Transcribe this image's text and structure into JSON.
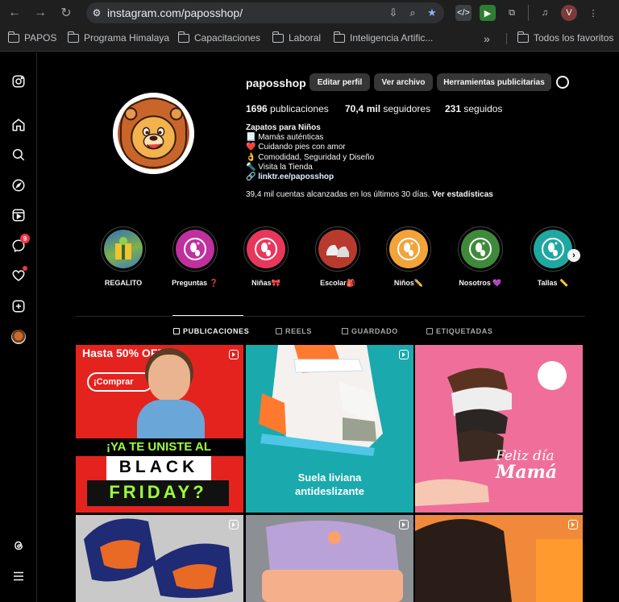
{
  "browser": {
    "url": "instagram.com/paposshop/",
    "profile_initial": "V",
    "bookmarks": [
      "PAPOS",
      "Programa Himalaya",
      "Capacitaciones",
      "Laboral",
      "Inteligencia Artific..."
    ],
    "more_label": "»",
    "all_bookmarks": "Todos los favoritos"
  },
  "sidebar": {
    "messages_badge": "9"
  },
  "profile": {
    "username": "paposshop",
    "edit_button": "Editar perfil",
    "archive_button": "Ver archivo",
    "ads_button": "Herramientas publicitarias",
    "posts_count": "1696",
    "posts_label": "publicaciones",
    "followers_count": "70,4 mil",
    "followers_label": "seguidores",
    "following_count": "231",
    "following_label": "seguidos",
    "bio_name": "Zapatos para Niños",
    "bio_lines": [
      "📃 Mamás auténticas",
      "❤️ Cuidando pies con amor",
      "👌 Comodidad, Seguridad y Diseño",
      "🔦 Visita la Tienda"
    ],
    "bio_link": "🔗 linktr.ee/paposshop",
    "reach_text": "39,4 mil cuentas alcanzadas en los últimos 30 días.",
    "reach_link": "Ver estadísticas"
  },
  "highlights": [
    {
      "label": "REGALITO",
      "color": "#3b7bbf"
    },
    {
      "label": "Preguntas ❓",
      "color": "#c0309e"
    },
    {
      "label": "Niñas🎀",
      "color": "#e8375c"
    },
    {
      "label": "Escolar🎒",
      "color": "#b83a2e"
    },
    {
      "label": "Niños✏️",
      "color": "#f2a33a"
    },
    {
      "label": "Nosotros 💜",
      "color": "#3f8a3a"
    },
    {
      "label": "Tallas 📏",
      "color": "#1fa7a0"
    }
  ],
  "tabs": [
    "PUBLICACIONES",
    "REELS",
    "GUARDADO",
    "ETIQUETADAS"
  ],
  "posts": {
    "p1": {
      "top": "Hasta 50% OFF",
      "cta": "¡Comprar",
      "line1": "¡YA TE UNISTE AL",
      "line2": "BLACK",
      "line3": "FRIDAY?"
    },
    "p2": {
      "line1": "Suela liviana",
      "line2": "antideslizante"
    },
    "p3": {
      "line1": "Feliz día",
      "line2": "Mamá"
    }
  }
}
